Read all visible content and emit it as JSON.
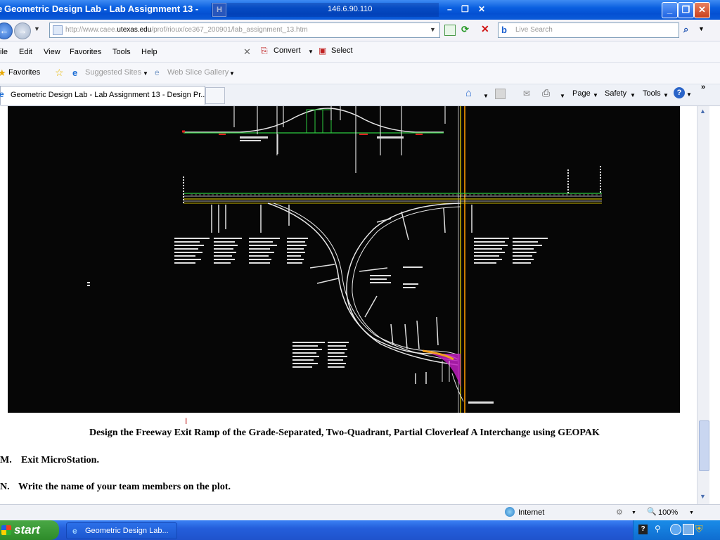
{
  "window": {
    "title": "Geometric Design Lab - Lab Assignment 13 -",
    "remote_ip": "146.6.90.110"
  },
  "address": {
    "url_prefix": "http://www.caee.",
    "url_domain": "utexas.edu",
    "url_path": "/prof/rioux/ce367_200901/lab_assignment_13.htm",
    "search_placeholder": "Live Search"
  },
  "menu": {
    "items": [
      "ile",
      "Edit",
      "View",
      "Favorites",
      "Tools",
      "Help"
    ],
    "convert": "Convert",
    "select": "Select"
  },
  "favorites_bar": {
    "favorites": "Favorites",
    "suggested_sites": "Suggested Sites",
    "web_slice_gallery": "Web Slice Gallery"
  },
  "tabs": {
    "active_label": "Geometric Design Lab - Lab Assignment 13 - Design Pr...",
    "page_menu": "Page",
    "safety_menu": "Safety",
    "tools_menu": "Tools"
  },
  "content": {
    "caption": "Design the Freeway Exit Ramp of the Grade-Separated, Two-Quadrant, Partial Cloverleaf A Interchange using GEOPAK",
    "step_m_label": "M.",
    "step_m_text": "Exit MicroStation.",
    "step_n_label": "N.",
    "step_n_text": "Write the name of your team members on the plot.",
    "cursor_glyph": "I"
  },
  "status": {
    "zone": "Internet",
    "zoom": "100%"
  },
  "taskbar": {
    "start": "start",
    "task_label": "Geometric Design Lab..."
  },
  "colors": {
    "titlebar": "#0a5fe0",
    "drawing_bg": "#060606",
    "road_yellow": "#c8b400",
    "road_green": "#2ecc40",
    "ramp_magenta": "#c020c0",
    "start_green": "#3a9a35"
  }
}
